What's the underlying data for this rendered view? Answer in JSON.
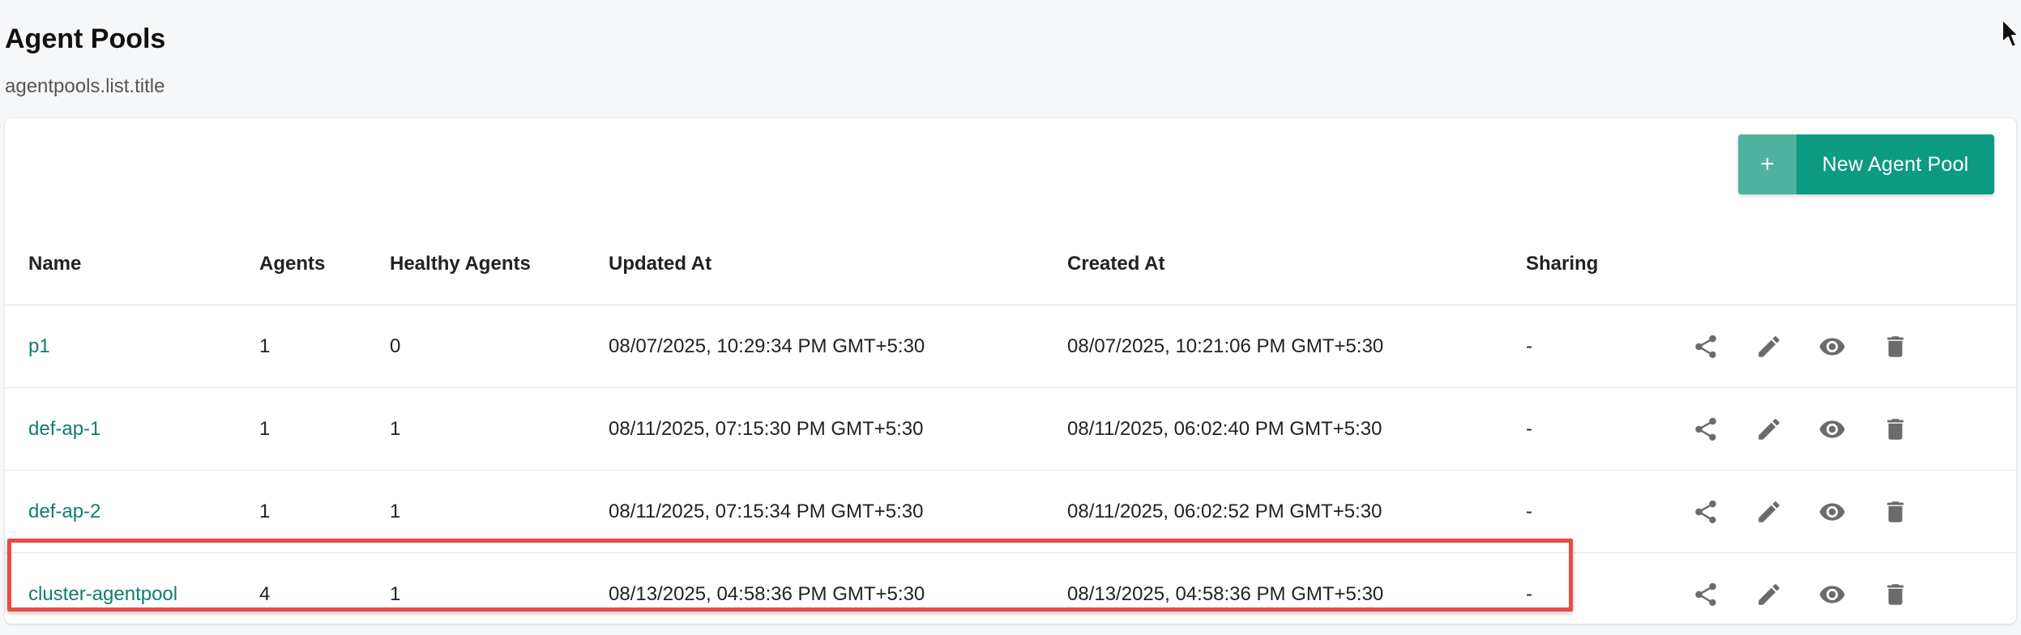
{
  "header": {
    "title": "Agent Pools",
    "subtitle": "agentpools.list.title"
  },
  "toolbar": {
    "new_button_icon": "+",
    "new_button_label": "New Agent Pool"
  },
  "table": {
    "columns": [
      "Name",
      "Agents",
      "Healthy Agents",
      "Updated At",
      "Created At",
      "Sharing"
    ],
    "rows": [
      {
        "name": "p1",
        "agents": "1",
        "healthy": "0",
        "updated": "08/07/2025, 10:29:34 PM GMT+5:30",
        "created": "08/07/2025, 10:21:06 PM GMT+5:30",
        "sharing": "-"
      },
      {
        "name": "def-ap-1",
        "agents": "1",
        "healthy": "1",
        "updated": "08/11/2025, 07:15:30 PM GMT+5:30",
        "created": "08/11/2025, 06:02:40 PM GMT+5:30",
        "sharing": "-"
      },
      {
        "name": "def-ap-2",
        "agents": "1",
        "healthy": "1",
        "updated": "08/11/2025, 07:15:34 PM GMT+5:30",
        "created": "08/11/2025, 06:02:52 PM GMT+5:30",
        "sharing": "-"
      },
      {
        "name": "cluster-agentpool",
        "agents": "4",
        "healthy": "1",
        "updated": "08/13/2025, 04:58:36 PM GMT+5:30",
        "created": "08/13/2025, 04:58:36 PM GMT+5:30",
        "sharing": "-"
      }
    ],
    "row_actions": [
      "share-icon",
      "edit-icon",
      "view-icon",
      "delete-icon"
    ],
    "highlighted_row": 3
  },
  "colors": {
    "accent": "#0d9a82",
    "accent_light": "#4fb29f",
    "link": "#0f7d6d",
    "highlight_border": "#ea4c45",
    "icon": "#6b6b6b"
  }
}
